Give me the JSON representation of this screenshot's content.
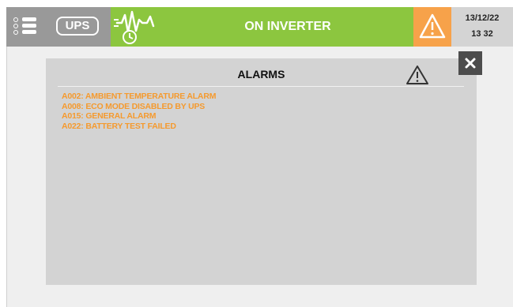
{
  "header": {
    "ups_label": "UPS",
    "status": "ON INVERTER",
    "date": "13/12/22",
    "time": "13 32"
  },
  "dialog": {
    "title": "ALARMS",
    "alarms": [
      "A002: AMBIENT TEMPERATURE ALARM",
      "A008: ECO MODE DISABLED BY UPS",
      "A015: GENERAL ALARM",
      "A022: BATTERY TEST FAILED"
    ]
  },
  "colors": {
    "header_green": "#8cc63f",
    "warning_orange": "#f7a24a",
    "alarm_text": "#f59a2e",
    "button_gray": "#999999"
  },
  "icons": {
    "menu": "menu-list-icon",
    "wave": "waveform-clock-icon",
    "warning": "warning-triangle-icon",
    "close": "close-icon"
  }
}
